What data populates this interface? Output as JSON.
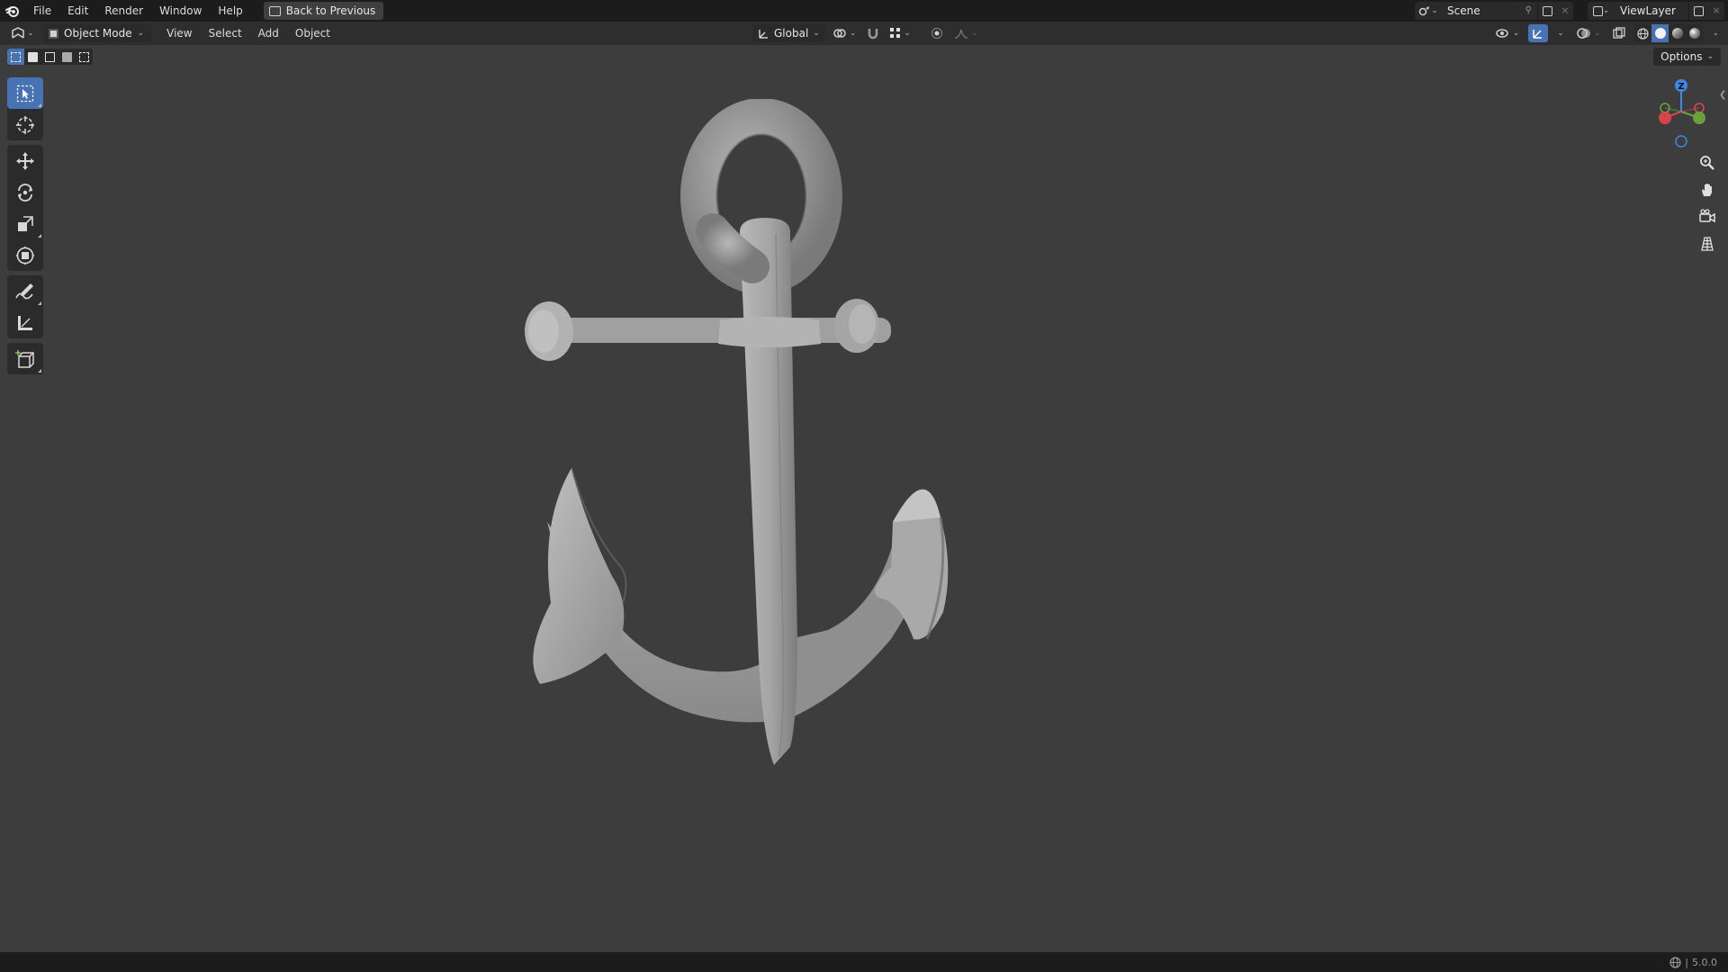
{
  "menubar": {
    "items": [
      "File",
      "Edit",
      "Render",
      "Window",
      "Help"
    ],
    "back_button": "Back to Previous"
  },
  "scene": {
    "name": "Scene",
    "view_layer": "ViewLayer"
  },
  "header": {
    "mode": "Object Mode",
    "menus": [
      "View",
      "Select",
      "Add",
      "Object"
    ],
    "orientation": "Global"
  },
  "viewport": {
    "options_label": "Options",
    "gizmo_axes": {
      "z": "Z"
    }
  },
  "toolbar": {
    "tools": [
      "select-box",
      "cursor",
      "move",
      "rotate",
      "scale",
      "transform",
      "annotate",
      "measure",
      "add-cube"
    ],
    "active_tool": "select-box"
  },
  "status": {
    "version": "5.0.0"
  },
  "colors": {
    "accent": "#4772b3",
    "background": "#3d3d3d",
    "axis_x": "#e2464d",
    "axis_y": "#6aa63a",
    "axis_z": "#3d89e3"
  }
}
